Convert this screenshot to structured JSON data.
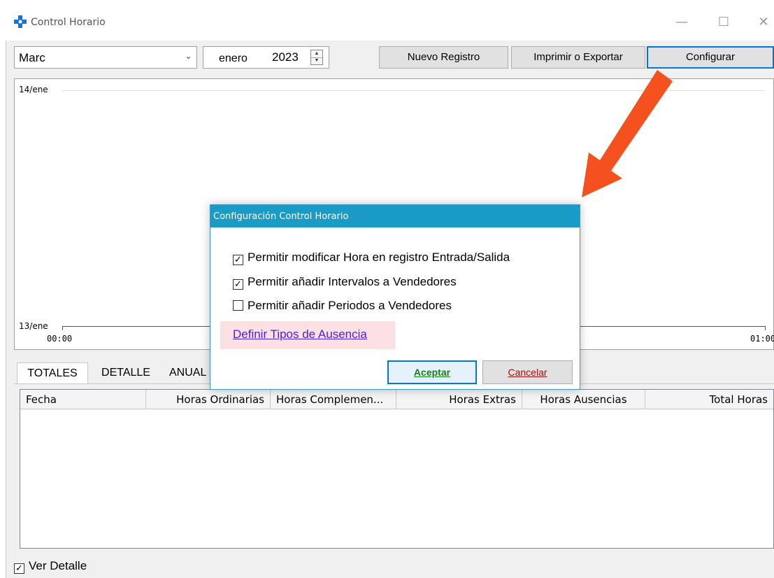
{
  "window": {
    "title": "Control Horario",
    "accent": "#0078d7",
    "minimize_glyph": "—",
    "maximize_glyph": "☐",
    "close_glyph": "✕"
  },
  "toolbar": {
    "employee": "Marc",
    "month": "enero",
    "year": "2023",
    "new_record_label": "Nuevo Registro",
    "print_export_label": "Imprimir o Exportar",
    "configure_label": "Configurar"
  },
  "timeline": {
    "y_top_label": "14/ene",
    "y_bottom_label": "13/ene",
    "x_start_label": "00:00",
    "x_end_label": "01:00"
  },
  "tabs": [
    "TOTALES",
    "DETALLE",
    "ANUAL"
  ],
  "grid": {
    "columns": [
      "Fecha",
      "Horas Ordinarias",
      "Horas Complemen...",
      "Horas Extras",
      "Horas Ausencias",
      "Total Horas"
    ],
    "rows": []
  },
  "footer": {
    "show_detail_label": "Ver Detalle",
    "show_detail_checked": true
  },
  "dialog": {
    "title": "Configuración Control Horario",
    "options": [
      {
        "label": "Permitir modificar Hora en registro Entrada/Salida",
        "checked": true
      },
      {
        "label": "Permitir añadir Intervalos a Vendedores",
        "checked": true
      },
      {
        "label": "Permitir añadir Periodos a Vendedores",
        "checked": false
      }
    ],
    "link_label": "Definir Tipos de Ausencia",
    "accept_label": "Aceptar",
    "cancel_label": "Cancelar",
    "title_color": "#199bc6",
    "link_color": "#4b1fd9",
    "highlight_color": "#fce0e4"
  },
  "annotation": {
    "arrow_color": "#f4511e"
  }
}
